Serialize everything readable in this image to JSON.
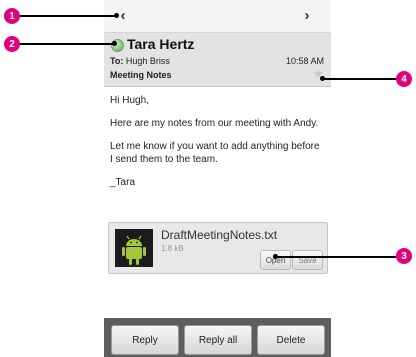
{
  "nav": {
    "prev_icon": "chevron-left-icon",
    "prev_glyph": "‹",
    "next_icon": "chevron-right-icon",
    "next_glyph": "›"
  },
  "message": {
    "sender": "Tara Hertz",
    "to_label": "To:",
    "to_name": "Hugh Briss",
    "time": "10:58 AM",
    "subject": "Meeting Notes",
    "star_icon": "star-icon",
    "presence_icon": "presence-status-icon"
  },
  "body": {
    "greeting": "Hi Hugh,",
    "para1": "Here are my notes from our meeting with Andy.",
    "para2": "Let me know if you want to add anything before I send them to the team.",
    "signature": "_Tara"
  },
  "attachment": {
    "filename": "DraftMeetingNotes.txt",
    "size": "1.8 kB",
    "open_label": "Open",
    "save_label": "Save",
    "thumb_icon": "android-robot-icon"
  },
  "actions": {
    "reply": "Reply",
    "reply_all": "Reply all",
    "delete": "Delete"
  },
  "callouts": [
    "1",
    "2",
    "3",
    "4"
  ],
  "colors": {
    "callout": "#e4007c",
    "bottom_bar": "#5e5e5e",
    "header_bg": "#e3e3e3",
    "presence": "#8fbf86"
  }
}
